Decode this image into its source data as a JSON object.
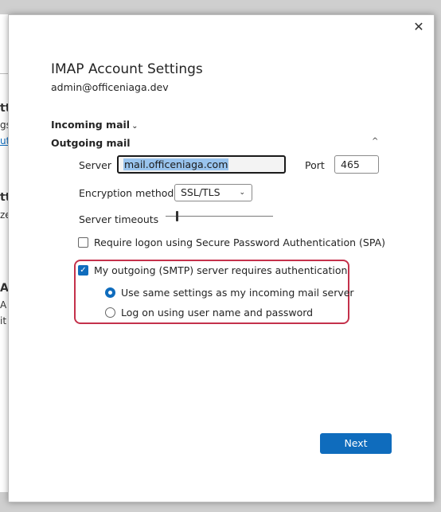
{
  "background_window": {
    "fragments": [
      {
        "text": "tt",
        "style": "bold"
      },
      {
        "text": "gs",
        "style": "normal"
      },
      {
        "text": "ut",
        "style": "link"
      },
      {
        "text": "tt",
        "style": "bold"
      },
      {
        "text": "ze",
        "style": "normal"
      },
      {
        "text": "Al",
        "style": "bold"
      },
      {
        "text": "A",
        "style": "normal"
      },
      {
        "text": "it",
        "style": "normal"
      }
    ]
  },
  "dialog": {
    "close_symbol": "✕",
    "title": "IMAP Account Settings",
    "email": "admin@officeniaga.dev",
    "incoming": {
      "label": "Incoming mail",
      "chevron": "⌄"
    },
    "outgoing": {
      "label": "Outgoing mail",
      "collapse_chevron": "^",
      "server_label": "Server",
      "server_value": "mail.officeniaga.com",
      "port_label": "Port",
      "port_value": "465",
      "encryption_label": "Encryption method",
      "encryption_value": "SSL/TLS",
      "encryption_arrow": "⌄",
      "timeouts_label": "Server timeouts",
      "spa_label": "Require logon using Secure Password Authentication (SPA)",
      "spa_checked": false,
      "smtp_auth_label": "My outgoing (SMTP) server requires authentication",
      "smtp_auth_checked": true,
      "check_mark": "✓",
      "radio_same_label": "Use same settings as my incoming mail server",
      "radio_logon_label": "Log on using user name and password",
      "selected_radio": "same"
    },
    "next_label": "Next"
  },
  "colors": {
    "accent": "#0f6cbd",
    "highlight_border": "#c4314b",
    "selection": "#99c4ee"
  }
}
